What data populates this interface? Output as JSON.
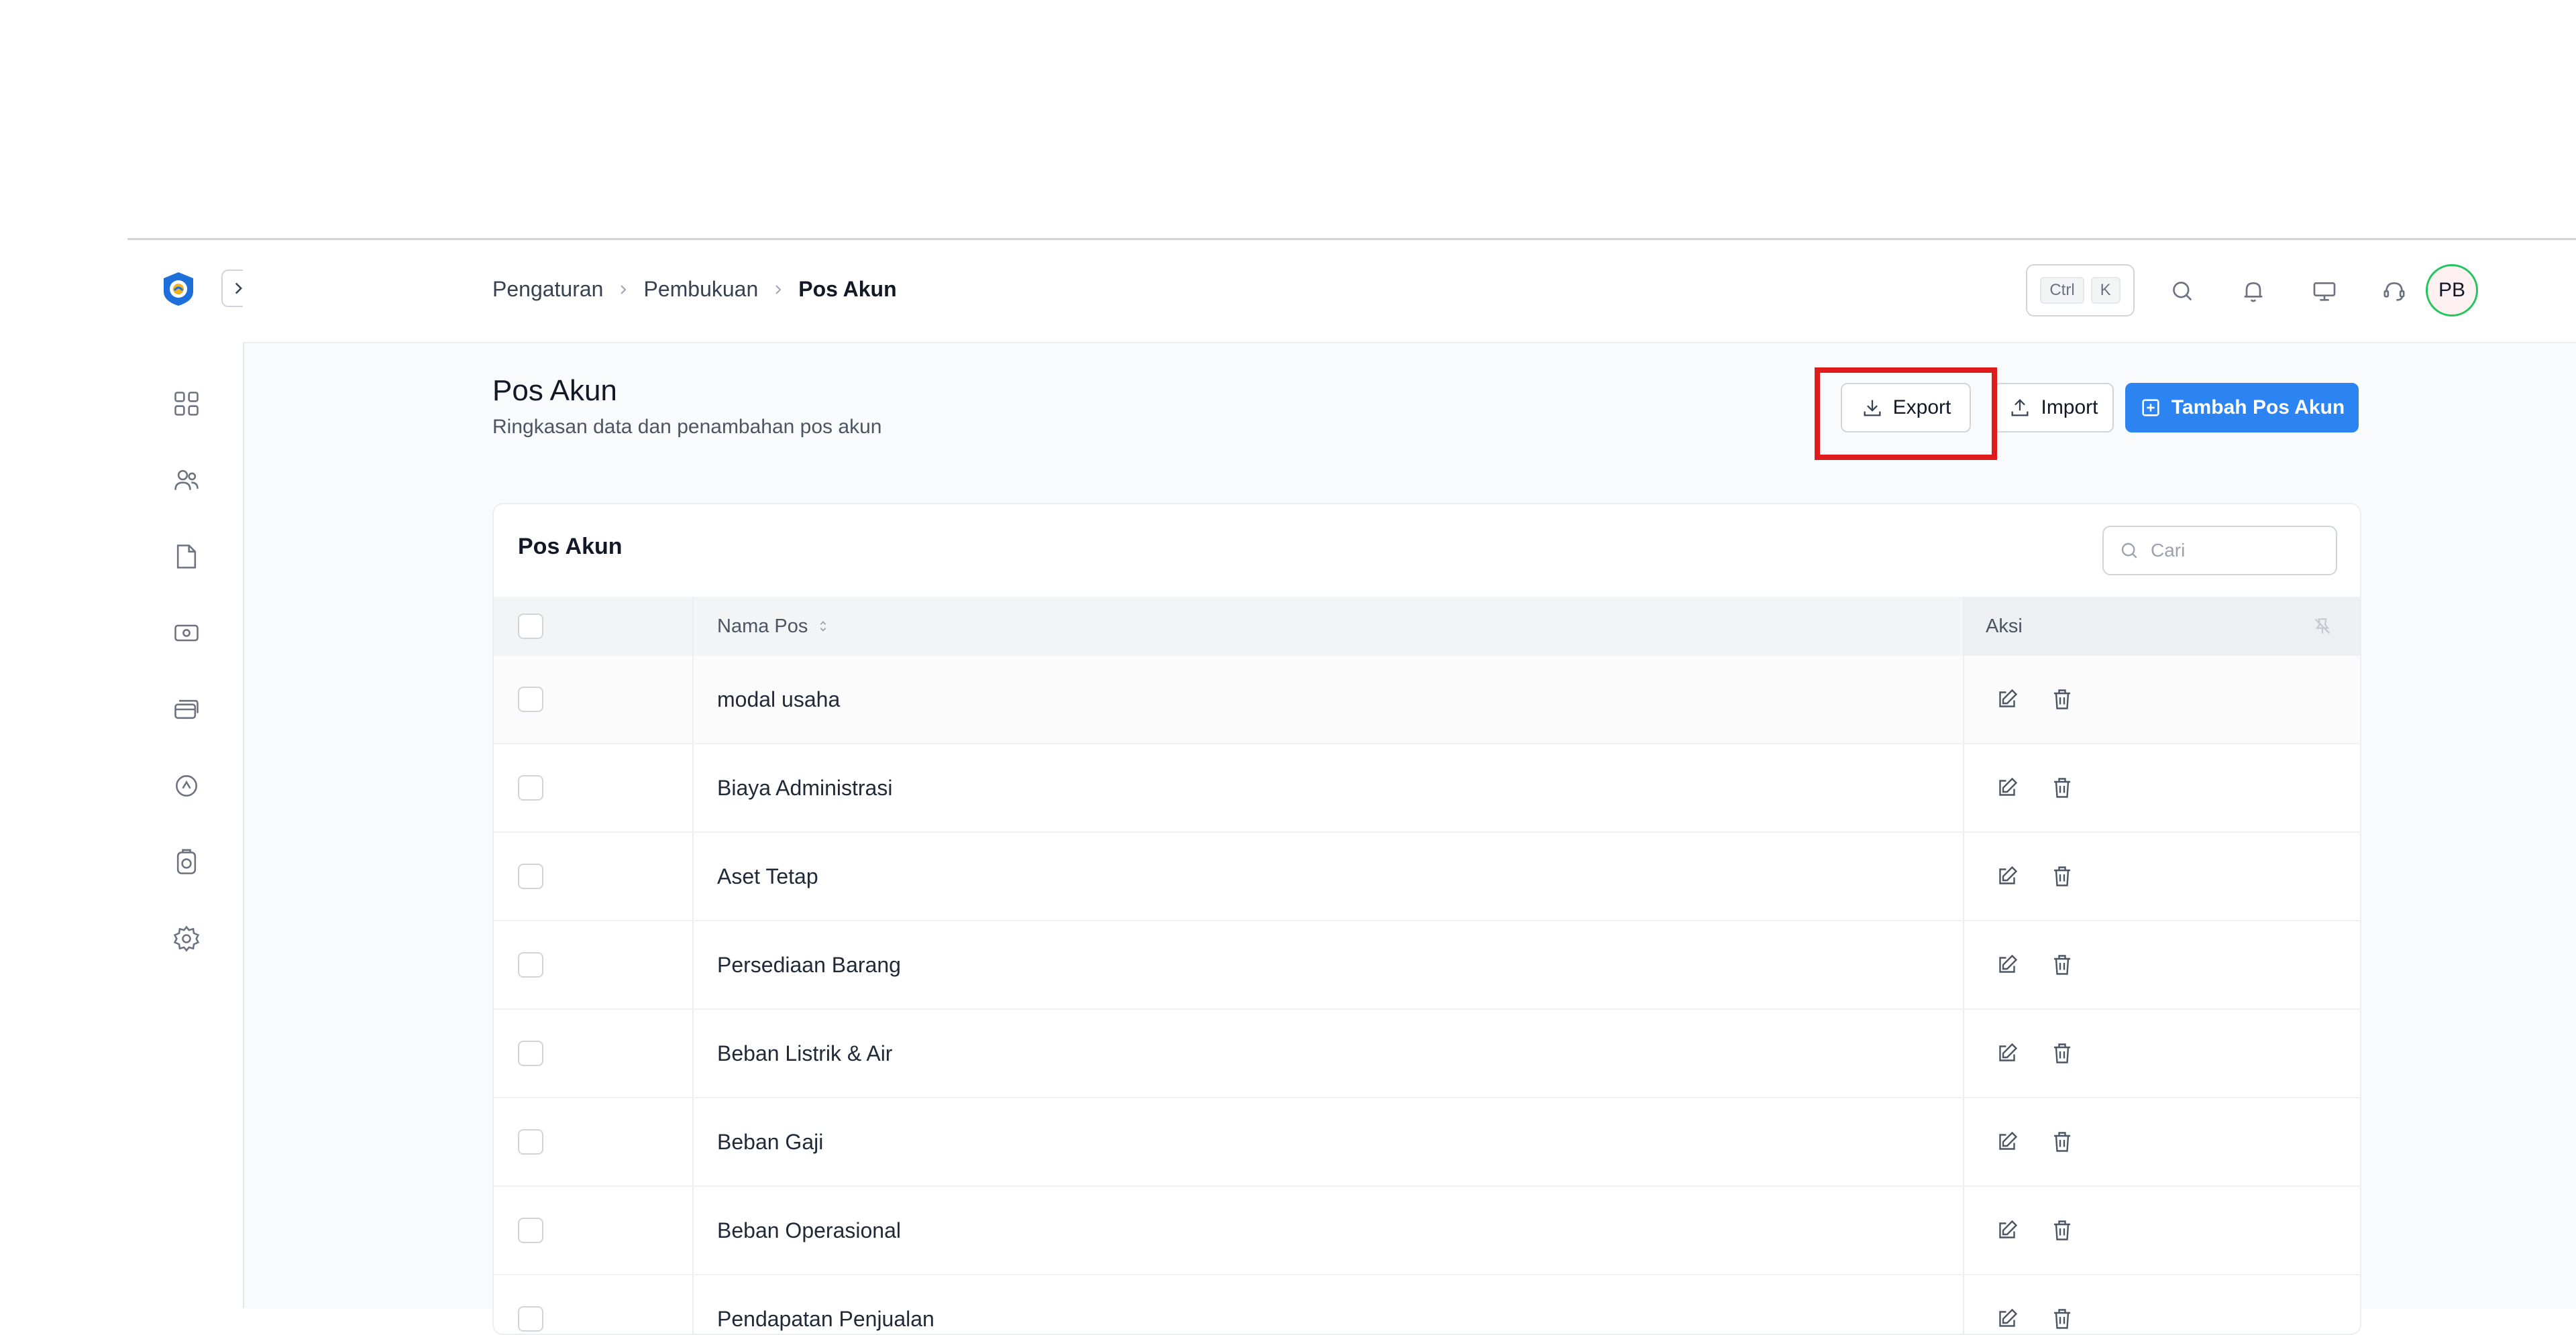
{
  "breadcrumb": {
    "items": [
      "Pengaturan",
      "Pembukuan"
    ],
    "current": "Pos Akun"
  },
  "header": {
    "kbd_ctrl": "Ctrl",
    "kbd_k": "K",
    "avatar_initials": "PB",
    "icons": [
      "search-icon",
      "bell-icon",
      "monitor-icon",
      "headset-icon"
    ]
  },
  "sidebar": {
    "items": [
      "dashboard-icon",
      "users-icon",
      "folder-icon",
      "wallet-icon",
      "cards-icon",
      "chart-icon",
      "camera-icon",
      "gear-icon"
    ]
  },
  "page": {
    "title": "Pos Akun",
    "subtitle": "Ringkasan data dan penambahan pos akun"
  },
  "actions": {
    "export_label": "Export",
    "import_label": "Import",
    "add_label": "Tambah Pos Akun"
  },
  "card": {
    "title": "Pos Akun",
    "search_placeholder": "Cari"
  },
  "table": {
    "columns": {
      "name": "Nama Pos",
      "actions": "Aksi"
    },
    "rows": [
      "modal usaha",
      "Biaya Administrasi",
      "Aset Tetap",
      "Persediaan Barang",
      "Beban Listrik & Air",
      "Beban Gaji",
      "Beban Operasional",
      "Pendapatan Penjualan"
    ]
  },
  "colors": {
    "primary": "#2b84f2",
    "highlight": "#e01b1b",
    "avatar_border": "#22c55e"
  }
}
